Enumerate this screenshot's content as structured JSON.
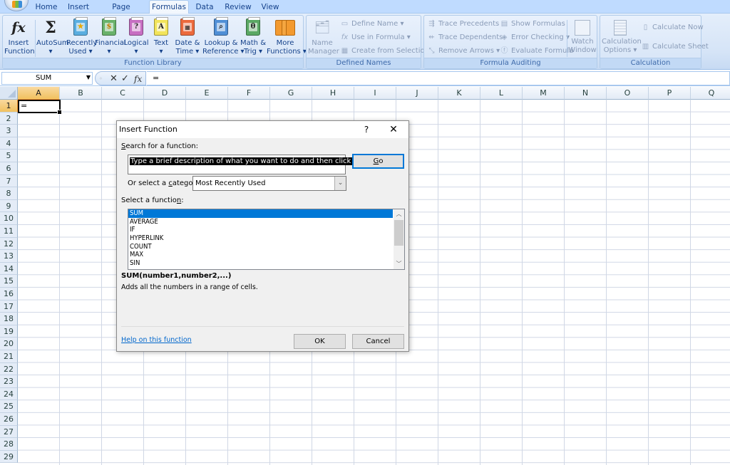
{
  "ribbon_tabs": [
    {
      "label": "Home",
      "active": false
    },
    {
      "label": "Insert",
      "active": false
    },
    {
      "label": "Page Layout",
      "active": false
    },
    {
      "label": "Formulas",
      "active": true
    },
    {
      "label": "Data",
      "active": false
    },
    {
      "label": "Review",
      "active": false
    },
    {
      "label": "View",
      "active": false
    }
  ],
  "ribbon": {
    "function_library": {
      "label": "Function Library",
      "insert_function": {
        "line1": "Insert",
        "line2": "Function",
        "icon": "fx-icon"
      },
      "autosum": {
        "line1": "AutoSum",
        "line2": "▾",
        "icon": "sigma-icon"
      },
      "recently_used": {
        "line1": "Recently",
        "line2": "Used ▾",
        "icon": "star-book-icon",
        "color": "#5aaee0"
      },
      "financial": {
        "line1": "Financial",
        "line2": "▾",
        "icon": "financial-book-icon",
        "color": "#69b26b"
      },
      "logical": {
        "line1": "Logical",
        "line2": "▾",
        "icon": "question-book-icon",
        "color": "#c76fc2"
      },
      "text": {
        "line1": "Text",
        "line2": "▾",
        "icon": "text-book-icon",
        "color": "#f2e45a"
      },
      "date_time": {
        "line1": "Date &",
        "line2": "Time ▾",
        "icon": "calendar-book-icon",
        "color": "#ec6a3d"
      },
      "lookup": {
        "line1": "Lookup &",
        "line2": "Reference ▾",
        "icon": "magnifier-book-icon",
        "color": "#4f8fd6"
      },
      "math_trig": {
        "line1": "Math &",
        "line2": "Trig ▾",
        "icon": "theta-book-icon",
        "color": "#5aa864"
      },
      "more_functions": {
        "line1": "More",
        "line2": "Functions ▾",
        "icon": "books-icon",
        "color": "#f39a2f"
      }
    },
    "defined_names": {
      "label": "Defined Names",
      "name_manager": {
        "line1": "Name",
        "line2": "Manager"
      },
      "define_name": "Define Name ▾",
      "use_in_formula": "Use in Formula ▾",
      "create_from_selection": "Create from Selection"
    },
    "formula_auditing": {
      "label": "Formula Auditing",
      "trace_precedents": "Trace Precedents",
      "trace_dependents": "Trace Dependents",
      "remove_arrows": "Remove Arrows ▾",
      "show_formulas": "Show Formulas",
      "error_checking": "Error Checking ▾",
      "evaluate_formula": "Evaluate Formula",
      "watch_window": {
        "line1": "Watch",
        "line2": "Window"
      }
    },
    "calculation": {
      "label": "Calculation",
      "calculation_options": {
        "line1": "Calculation",
        "line2": "Options ▾"
      },
      "calculate_now": "Calculate Now",
      "calculate_sheet": "Calculate Sheet"
    }
  },
  "formula_bar": {
    "name_box": "SUM",
    "cancel_glyph": "✕",
    "enter_glyph": "✓",
    "fx_glyph": "fx",
    "formula": "="
  },
  "sheet": {
    "columns": [
      "A",
      "B",
      "C",
      "D",
      "E",
      "F",
      "G",
      "H",
      "I",
      "J",
      "K",
      "L",
      "M",
      "N",
      "O",
      "P",
      "Q"
    ],
    "rows": [
      "1",
      "2",
      "3",
      "4",
      "5",
      "6",
      "7",
      "8",
      "9",
      "10",
      "11",
      "12",
      "13",
      "14",
      "15",
      "16",
      "17",
      "18",
      "19",
      "20",
      "21",
      "22",
      "23",
      "24",
      "25",
      "26",
      "27",
      "28",
      "29"
    ],
    "active_cell": "A1",
    "active_cell_value": "="
  },
  "dialog": {
    "title": "Insert Function",
    "help_glyph": "?",
    "close_glyph": "✕",
    "search_label_accel": "S",
    "search_label_rest": "earch for a function:",
    "search_value": "Type a brief description of what you want to do and then click Go",
    "go_accel": "G",
    "go_rest": "o",
    "category_label_pre": "Or select a ",
    "category_label_accel": "c",
    "category_label_post": "ategory:",
    "category_value": "Most Recently Used",
    "select_label_pre": "Select a functio",
    "select_label_accel": "n",
    "select_label_post": ":",
    "functions": [
      "SUM",
      "AVERAGE",
      "IF",
      "HYPERLINK",
      "COUNT",
      "MAX",
      "SIN"
    ],
    "selected_function": "SUM",
    "signature": "SUM(number1,number2,...)",
    "description": "Adds all the numbers in a range of cells.",
    "help_link": "Help on this function",
    "ok_label": "OK",
    "cancel_label": "Cancel"
  }
}
